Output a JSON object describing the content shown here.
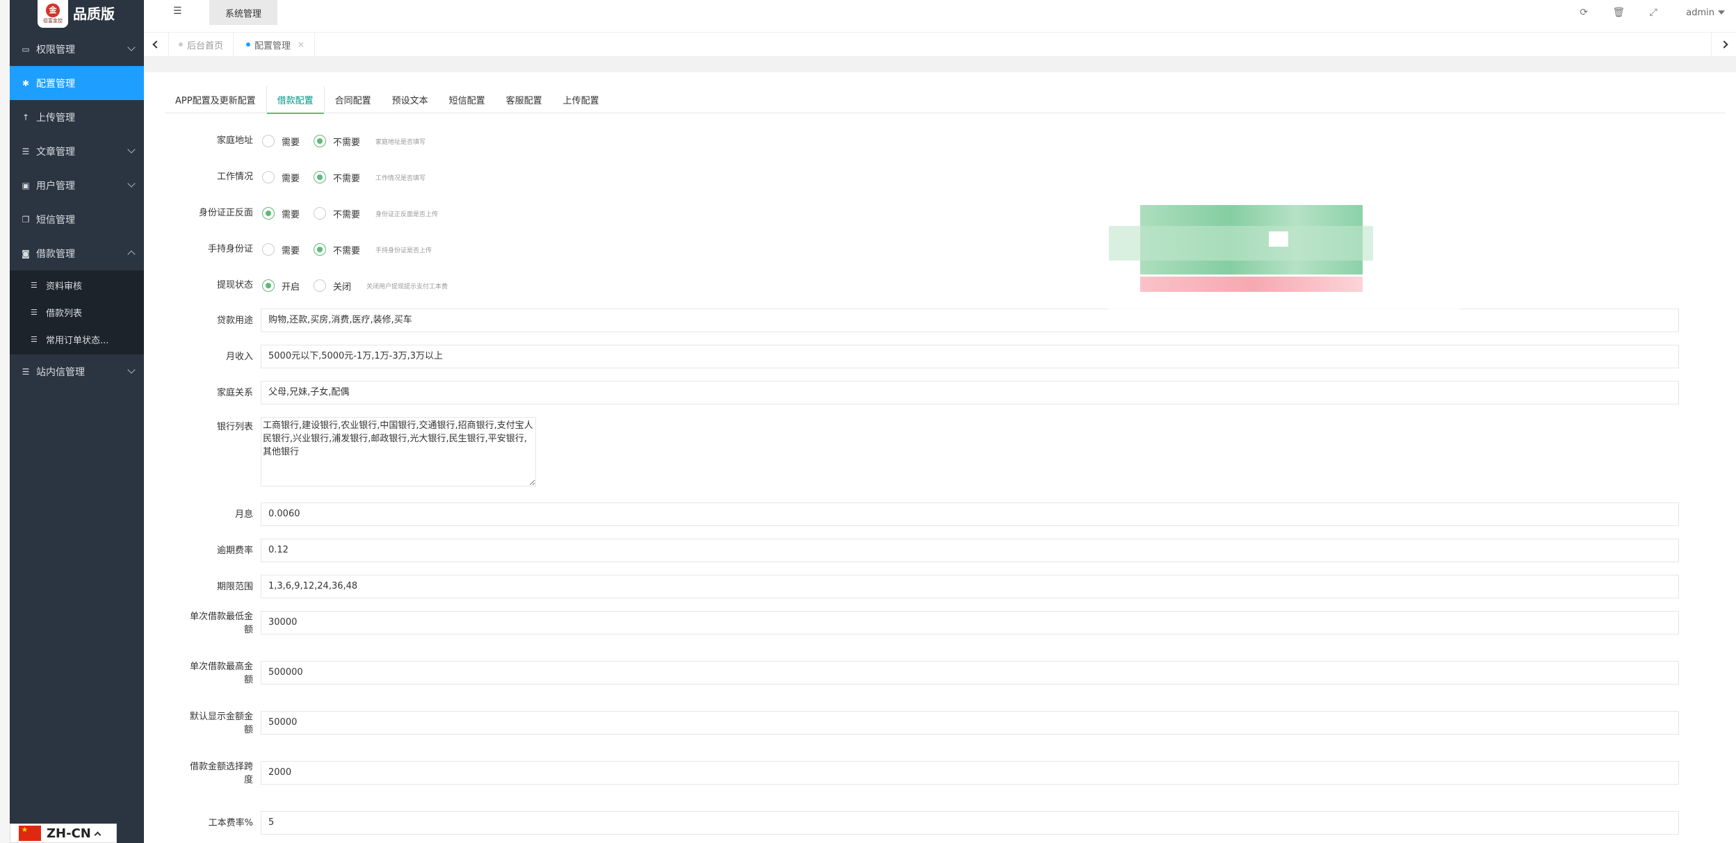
{
  "brand": {
    "logo_text": "品质版",
    "logo_badge": "金",
    "logo_sub": "佰富金控"
  },
  "sidebar": {
    "items": [
      {
        "label": "权限管理",
        "icon": "laptop-icon",
        "glyph": "▭",
        "expandable": true
      },
      {
        "label": "配置管理",
        "icon": "gear-icon",
        "glyph": "✱",
        "active": true
      },
      {
        "label": "上传管理",
        "icon": "upload-arrow-icon",
        "glyph": "↑"
      },
      {
        "label": "文章管理",
        "icon": "list-icon",
        "glyph": "☰",
        "expandable": true
      },
      {
        "label": "用户管理",
        "icon": "user-card-icon",
        "glyph": "▣",
        "expandable": true
      },
      {
        "label": "短信管理",
        "icon": "copy-icon",
        "glyph": "❐"
      },
      {
        "label": "借款管理",
        "icon": "money-icon",
        "glyph": "◙",
        "expanded": true
      }
    ],
    "sub_items": [
      {
        "label": "资料审核",
        "glyph": "☰"
      },
      {
        "label": "借款列表",
        "glyph": "☰"
      },
      {
        "label": "常用订单状态...",
        "glyph": "☰"
      }
    ],
    "after_items": [
      {
        "label": "站内信管理",
        "glyph": "☰",
        "expandable": true
      }
    ]
  },
  "language": {
    "label": "ZH-CN"
  },
  "header": {
    "menu_glyph": "☰",
    "system_tab": "系统管理",
    "icons": [
      {
        "name": "refresh-icon",
        "glyph": "⟳"
      },
      {
        "name": "trash-icon",
        "glyph": "🗑"
      },
      {
        "name": "fullscreen-icon",
        "glyph": "⤢"
      }
    ],
    "user": "admin"
  },
  "page_tabs": [
    {
      "label": "后台首页",
      "active": false
    },
    {
      "label": "配置管理",
      "active": true,
      "close": "×"
    }
  ],
  "content_tabs": [
    "APP配置及更新配置",
    "借款配置",
    "合同配置",
    "预设文本",
    "短信配置",
    "客服配置",
    "上传配置"
  ],
  "active_content_tab": 1,
  "form": {
    "radio_rows": [
      {
        "label": "家庭地址",
        "opt1": "需要",
        "opt2": "不需要",
        "selected": 2,
        "hint": "家庭地址是否填写"
      },
      {
        "label": "工作情况",
        "opt1": "需要",
        "opt2": "不需要",
        "selected": 2,
        "hint": "工作情况是否填写"
      },
      {
        "label": "身份证正反面",
        "opt1": "需要",
        "opt2": "不需要",
        "selected": 1,
        "hint": "身份证正反面是否上传"
      },
      {
        "label": "手持身份证",
        "opt1": "需要",
        "opt2": "不需要",
        "selected": 2,
        "hint": "手持身份证是否上传"
      },
      {
        "label": "提现状态",
        "opt1": "开启",
        "opt2": "关闭",
        "selected": 1,
        "hint": "关闭用户提现提示支付工本费"
      }
    ],
    "text_rows": [
      {
        "label": "贷款用途",
        "value": "购物,还款,买房,消费,医疗,装修,买车"
      },
      {
        "label": "月收入",
        "value": "5000元以下,5000元-1万,1万-3万,3万以上"
      },
      {
        "label": "家庭关系",
        "value": "父母,兄妹,子女,配偶"
      }
    ],
    "bank_label": "银行列表",
    "bank_value": "工商银行,建设银行,农业银行,中国银行,交通银行,招商银行,支付宝人民银行,兴业银行,浦发银行,邮政银行,光大银行,民生银行,平安银行,其他银行",
    "rate_rows": [
      {
        "label": "月息",
        "value": "0.0060"
      },
      {
        "label": "逾期费率",
        "value": "0.12"
      },
      {
        "label": "期限范围",
        "value": "1,3,6,9,12,24,36,48"
      }
    ],
    "amount_rows": [
      {
        "label_1": "单次借款最低金",
        "label_2": "额",
        "value": "30000"
      },
      {
        "label_1": "单次借款最高金",
        "label_2": "额",
        "value": "500000"
      },
      {
        "label_1": "默认显示金额金",
        "label_2": "额",
        "value": "50000"
      },
      {
        "label_1": "借款金额选择跨",
        "label_2": "度",
        "value": "2000"
      }
    ],
    "cost_rate_label": "工本费率%",
    "cost_rate_value": "5"
  },
  "colors": {
    "sidebar_bg": "#2b3541",
    "active_blue": "#1e9fff",
    "radio_green": "#5fb878",
    "tab_green": "#009688"
  }
}
